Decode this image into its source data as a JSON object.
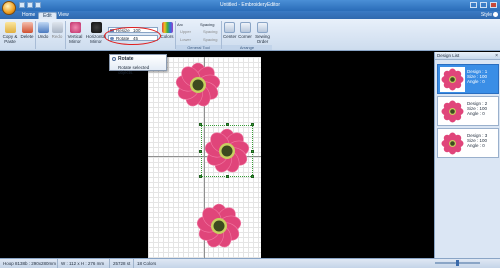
{
  "window": {
    "title": "Untitled - EmbroideryEditor"
  },
  "tabs": [
    {
      "label": "Home",
      "active": false
    },
    {
      "label": "Edit",
      "active": true
    },
    {
      "label": "View",
      "active": false
    }
  ],
  "style_menu": "Style",
  "ribbon": {
    "copy_paste": "Copy & Paste",
    "delete": "Delete",
    "undo": "Undo",
    "redo": "Redo",
    "vertical_mirror": "Vertical Mirror",
    "horizontal_mirror": "Horizontal Mirror",
    "resize_label": "Resize",
    "resize_value": "100",
    "rotate_label": "Rotate",
    "rotate_value": "45",
    "colors": "Colors",
    "arc": "Arc",
    "upper": "Upper",
    "lower": "Lower",
    "spacing": "Spacing",
    "spacing_a": "Spacing",
    "spacing_b": "Spacing",
    "center": "Center",
    "corner": "Corner",
    "sewing_order": "Sewing Order",
    "group_general_tool": "General Tool",
    "group_arrange": "Arrange"
  },
  "tooltip": {
    "title": "Rotate",
    "description": "Rotate selected objects."
  },
  "design_list": {
    "title": "Design List",
    "close_glyph": "×",
    "items": [
      {
        "design": "Design : 1",
        "size": "Size : 100",
        "angle": "Angle : 0",
        "selected": true
      },
      {
        "design": "Design : 2",
        "size": "Size : 100",
        "angle": "Angle : 0",
        "selected": false
      },
      {
        "design": "Design : 3",
        "size": "Size : 100",
        "angle": "Angle : 0",
        "selected": false
      }
    ]
  },
  "status": {
    "hoop": "Hoop 8138b : 290x280mm",
    "dims": "W : 112 x H : 276 mm",
    "stitches": "25728 st",
    "colors": "18 Colors"
  },
  "colors": {
    "petal": "#e0457a",
    "petal_light": "#f27aa4",
    "center": "#3d4a1f",
    "ring": "#c8d060",
    "accent_red": "#e02020",
    "ribbon_blue": "#2f68ae"
  }
}
